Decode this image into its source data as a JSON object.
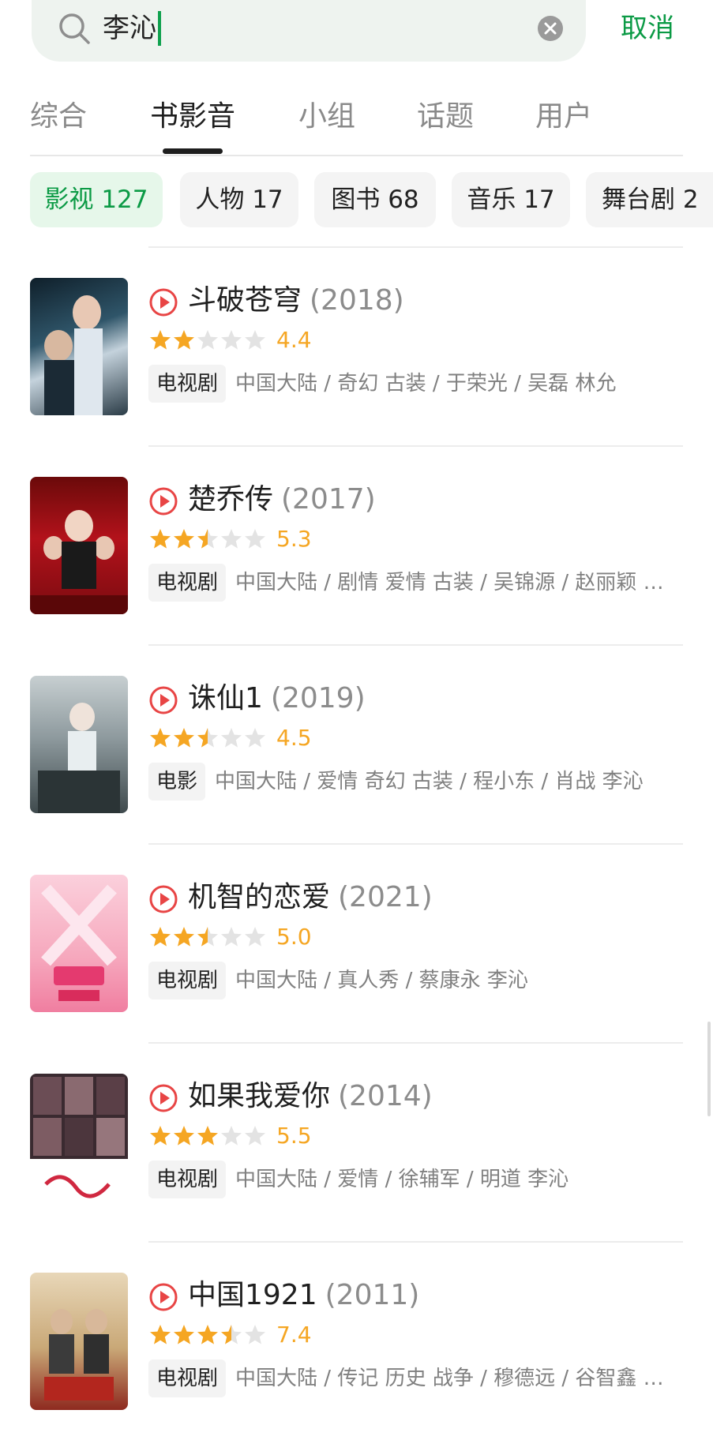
{
  "search": {
    "query": "李沁",
    "cancel_label": "取消"
  },
  "tabs": [
    {
      "label": "综合",
      "active": false
    },
    {
      "label": "书影音",
      "active": true
    },
    {
      "label": "小组",
      "active": false
    },
    {
      "label": "话题",
      "active": false
    },
    {
      "label": "用户",
      "active": false
    }
  ],
  "chips": [
    {
      "label": "影视 127",
      "active": true
    },
    {
      "label": "人物 17",
      "active": false
    },
    {
      "label": "图书 68",
      "active": false
    },
    {
      "label": "音乐 17",
      "active": false
    },
    {
      "label": "舞台剧 2",
      "active": false
    }
  ],
  "results": [
    {
      "title": "斗破苍穹",
      "year": "(2018)",
      "stars": 2,
      "rating": "4.4",
      "type": "电视剧",
      "meta": "中国大陆 / 奇幻 古装 / 于荣光 / 吴磊 林允"
    },
    {
      "title": "楚乔传",
      "year": "(2017)",
      "stars": 2.5,
      "rating": "5.3",
      "type": "电视剧",
      "meta": "中国大陆 / 剧情 爱情 古装 / 吴锦源 / 赵丽颖 …"
    },
    {
      "title": "诛仙1",
      "year": "(2019)",
      "stars": 2.5,
      "rating": "4.5",
      "type": "电影",
      "meta": "中国大陆 / 爱情 奇幻 古装 / 程小东 / 肖战 李沁"
    },
    {
      "title": "机智的恋爱",
      "year": "(2021)",
      "stars": 2.5,
      "rating": "5.0",
      "type": "电视剧",
      "meta": "中国大陆 / 真人秀 / 蔡康永 李沁"
    },
    {
      "title": "如果我爱你",
      "year": "(2014)",
      "stars": 3,
      "rating": "5.5",
      "type": "电视剧",
      "meta": "中国大陆 / 爱情 / 徐辅军 / 明道 李沁"
    },
    {
      "title": "中国1921",
      "year": "(2011)",
      "stars": 3.5,
      "rating": "7.4",
      "type": "电视剧",
      "meta": "中国大陆 / 传记 历史 战争 / 穆德远 / 谷智鑫 …"
    }
  ],
  "colors": {
    "accent_green": "#0b9a45",
    "star_yellow": "#f5a623",
    "play_red": "#e84545"
  }
}
